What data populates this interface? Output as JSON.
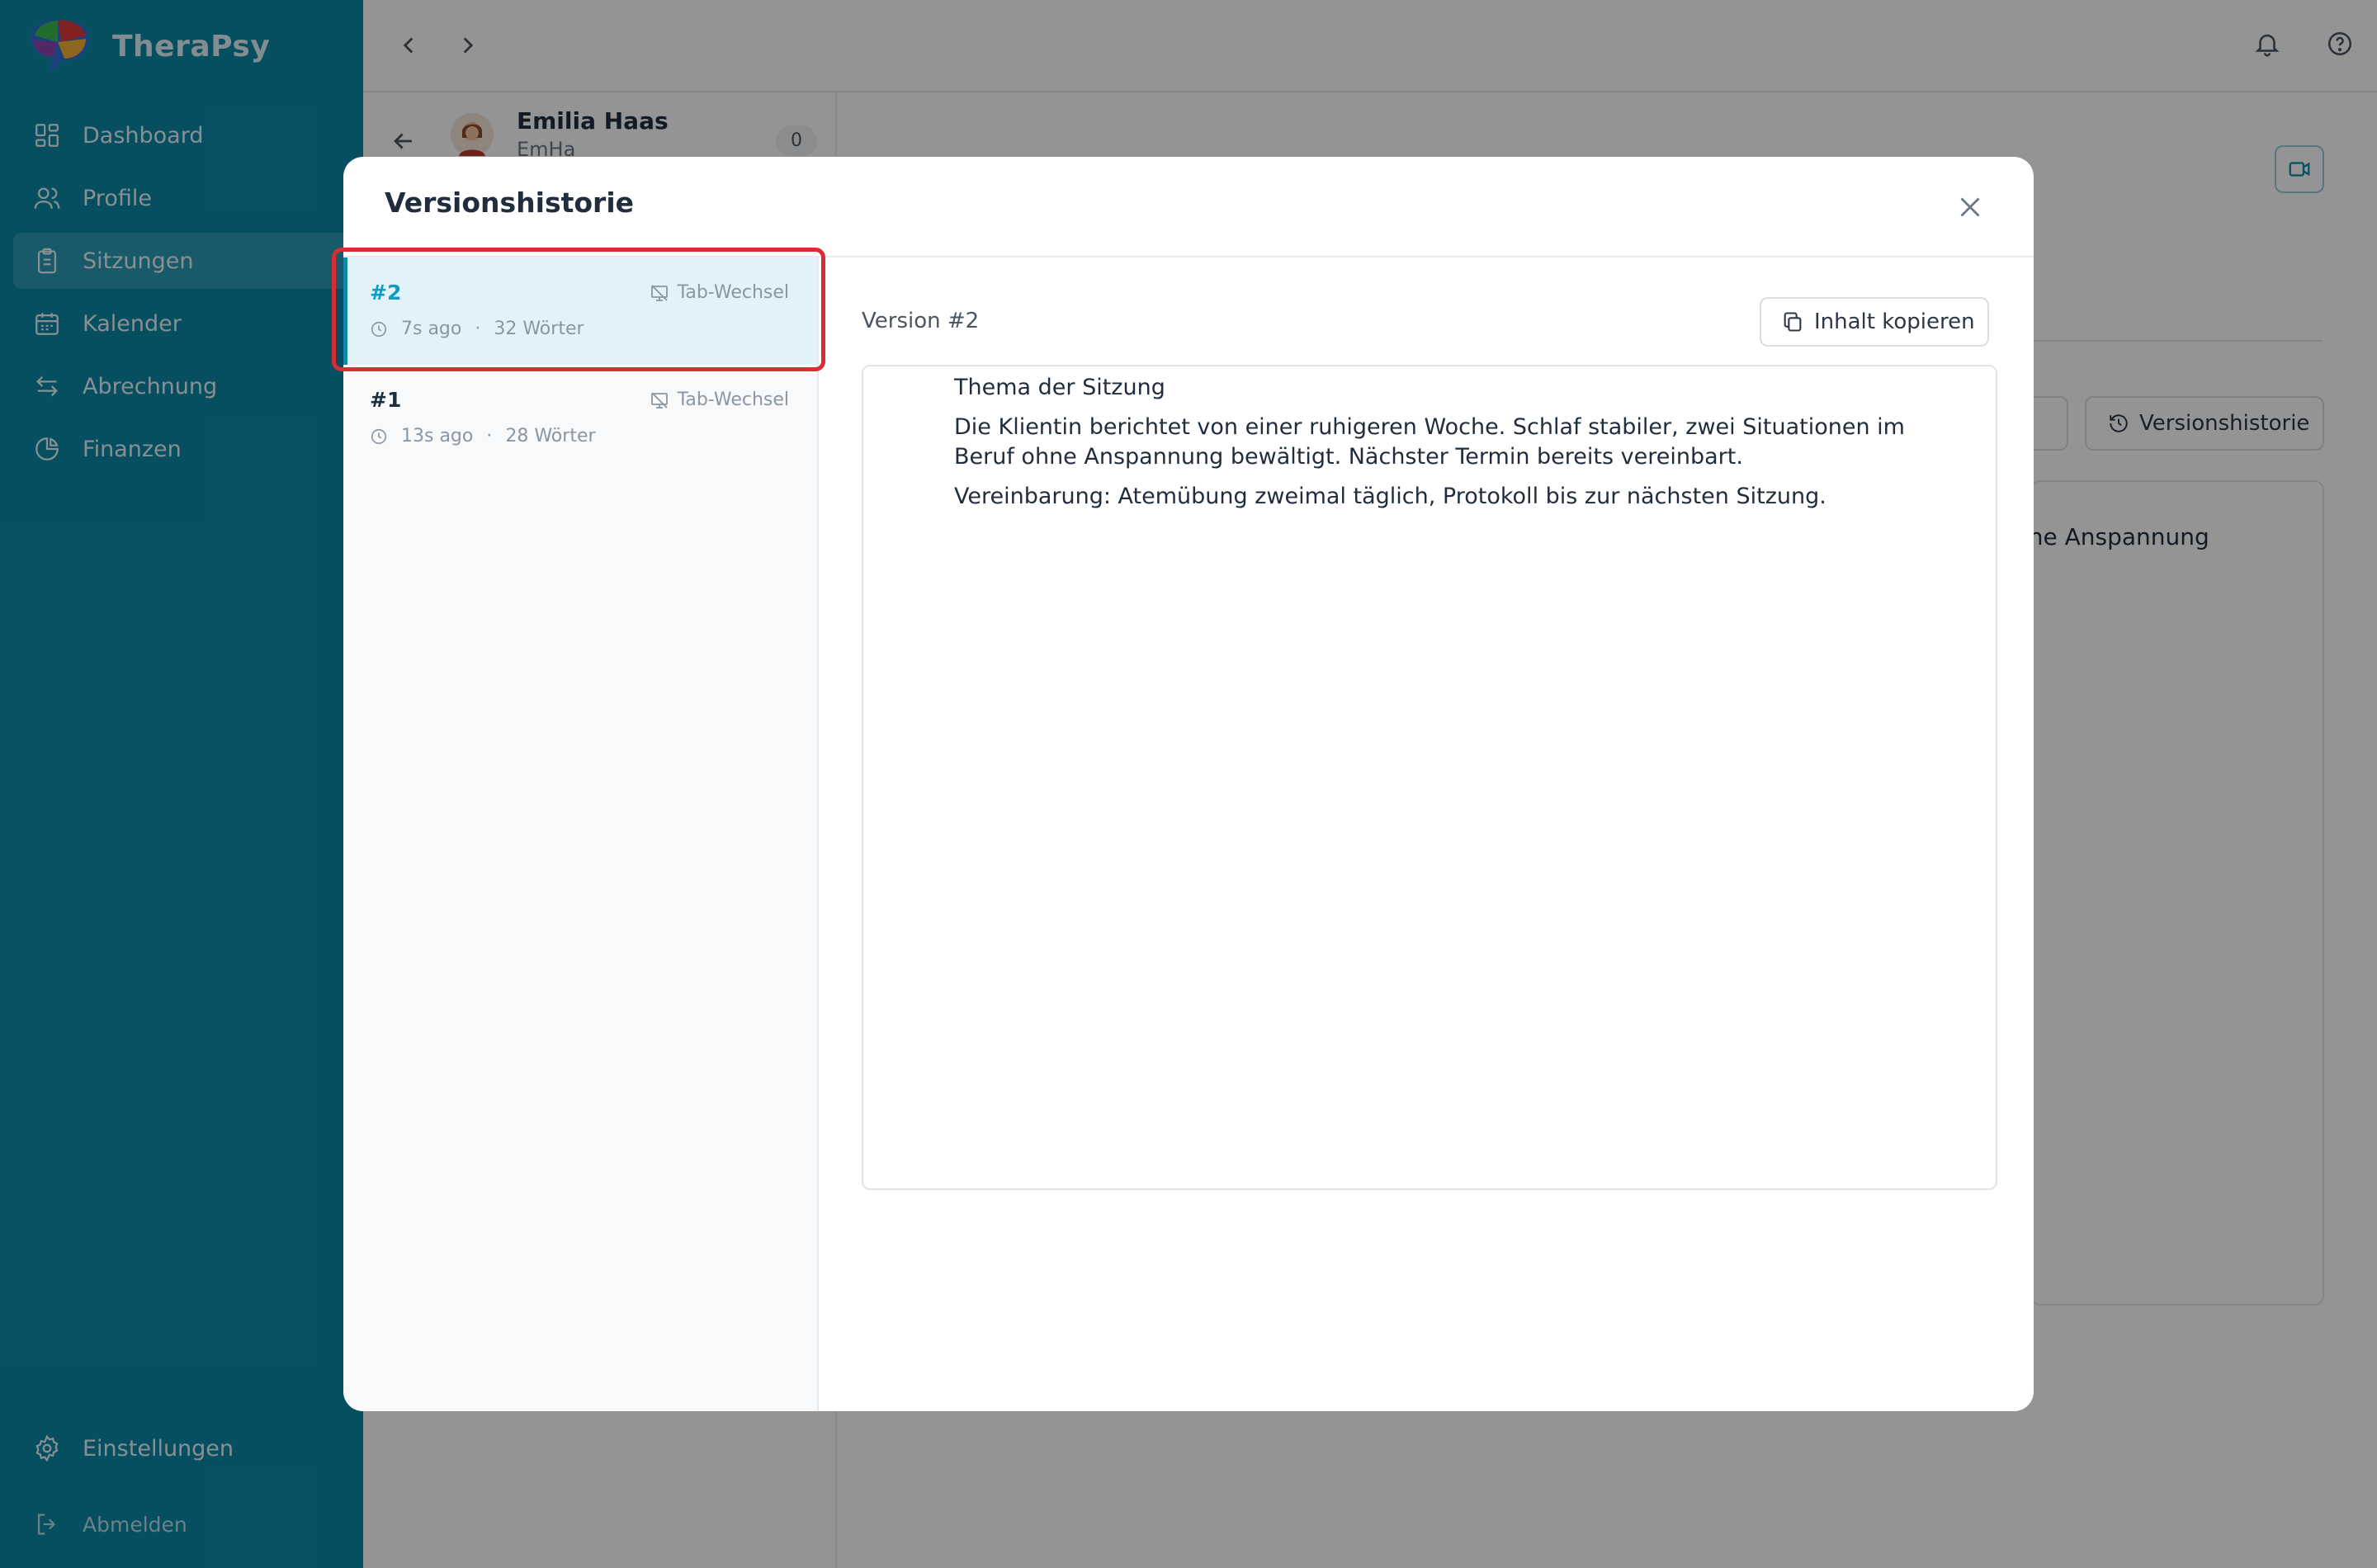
{
  "app": {
    "name": "TheraPsy"
  },
  "sidebar": {
    "items": [
      {
        "label": "Dashboard",
        "icon": "dashboard-icon"
      },
      {
        "label": "Profile",
        "icon": "users-icon"
      },
      {
        "label": "Sitzungen",
        "icon": "clipboard-icon",
        "active": true
      },
      {
        "label": "Kalender",
        "icon": "calendar-icon"
      },
      {
        "label": "Abrechnung",
        "icon": "transfer-icon"
      },
      {
        "label": "Finanzen",
        "icon": "pie-chart-icon"
      }
    ],
    "settings_label": "Einstellungen",
    "logout_label": "Abmelden"
  },
  "background": {
    "client_name": "Emilia Haas",
    "client_short": "EmHa",
    "count": "0",
    "versions_button_label": "Versionshistorie",
    "editor_snippet": "nne Anspannung"
  },
  "modal": {
    "title": "Versionshistorie",
    "versions": [
      {
        "number": "#2",
        "tag": "Tab-Wechsel",
        "age": "7s ago",
        "words": "32 Wörter",
        "selected": true
      },
      {
        "number": "#1",
        "tag": "Tab-Wechsel",
        "age": "13s ago",
        "words": "28 Wörter",
        "selected": false
      }
    ],
    "preview": {
      "label": "Version #2",
      "copy_label": "Inhalt kopieren",
      "heading": "Thema der Sitzung",
      "paragraph1": "Die Klientin berichtet von einer ruhigeren Woche. Schlaf stabiler, zwei Situationen im Beruf ohne Anspannung bewältigt. Nächster Termin bereits vereinbart.",
      "paragraph2": "Vereinbarung: Atemübung zweimal täglich, Protokoll bis zur nächsten Sitzung."
    }
  },
  "colors": {
    "sidebar": "#0c88a8",
    "accent": "#0c9cc4",
    "highlight": "#d92d33"
  }
}
